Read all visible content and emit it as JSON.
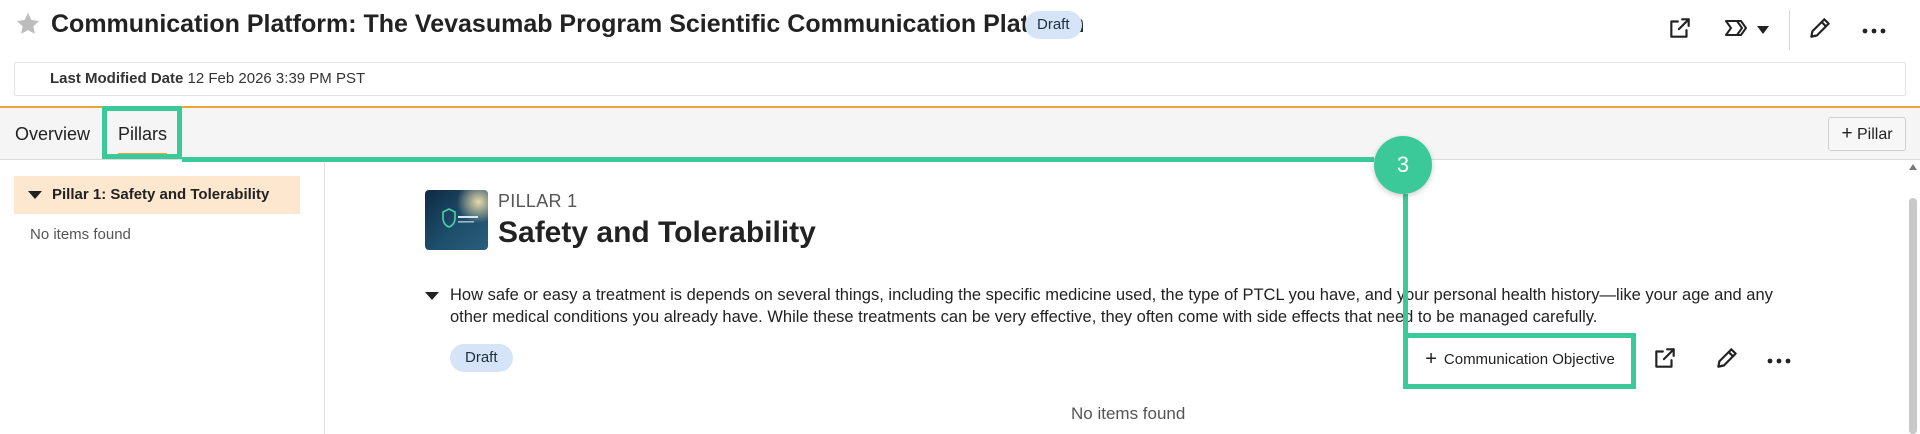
{
  "header": {
    "title": "Communication Platform: The Vevasumab Program Scientific Communication Platform",
    "status": "Draft",
    "icons": [
      "star-icon",
      "external-link-icon",
      "workflow-chevron-icon",
      "chevron-down-icon",
      "pencil-icon",
      "more-horizontal-icon"
    ]
  },
  "meta": {
    "label": "Last Modified Date",
    "value": "12 Feb 2026 3:39 PM PST"
  },
  "tabs": [
    {
      "label": "Overview"
    },
    {
      "label": "Pillars",
      "active": true
    }
  ],
  "add_pillar": {
    "label": "Pillar"
  },
  "left_panel": {
    "items": [
      {
        "label": "Pillar 1: Safety and Tolerability",
        "selected": true
      }
    ],
    "empty_text": "No items found"
  },
  "pillar": {
    "eyebrow": "PILLAR 1",
    "title": "Safety and Tolerability",
    "description": "How safe or easy a treatment is depends on several things, including the specific medicine used, the type of PTCL you have, and your personal health history—like your age and any other medical conditions you already have. While these treatments can be very effective, they often come with side effects that need to be managed carefully.",
    "status": "Draft",
    "add_objective": "Communication Objective",
    "empty_text": "No items found"
  },
  "annotation": {
    "step": "3"
  },
  "colors": {
    "accent_orange": "#f0a43a",
    "badge_blue": "#d6e4f8",
    "selected_item": "#fde8cf",
    "callout_green": "#3cc99a"
  }
}
